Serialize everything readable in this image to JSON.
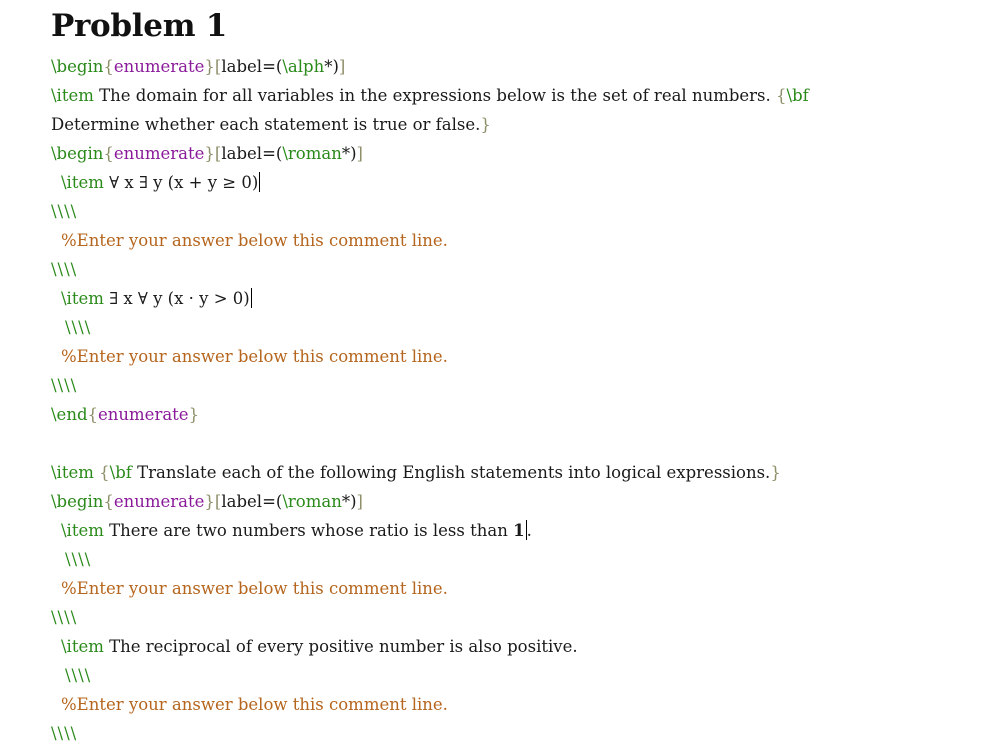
{
  "title": "Problem 1",
  "lines": {
    "begin_outer": {
      "cmd": "\\begin",
      "open": "{",
      "env": "enumerate",
      "close": "}",
      "opt_open": "[",
      "opt_text": "label=(",
      "opt_cmd": "\\alph",
      "opt_tail": "*)",
      "opt_close": "]"
    },
    "item_a": {
      "cmd": "\\item",
      "text": " The domain for all variables in the expressions below is the set of real numbers. ",
      "bf_open": "{",
      "bf_cmd": "\\bf",
      "bf_text": " Determine whether each statement is true or false.",
      "bf_close": "}"
    },
    "begin_inner1": {
      "cmd": "\\begin",
      "open": "{",
      "env": "enumerate",
      "close": "}",
      "opt_open": "[",
      "opt_text": "label=(",
      "opt_cmd": "\\roman",
      "opt_tail": "*)",
      "opt_close": "]"
    },
    "item_a1": {
      "cmd": "\\item",
      "math": "∀ x ∃ y (x + y ≥ 0)"
    },
    "newline_1": "\\\\\\\\",
    "comment_1": "%Enter your answer below this comment line.",
    "newline_2": "\\\\\\\\",
    "item_a2": {
      "cmd": "\\item",
      "math": "∃ x ∀ y (x · y > 0)"
    },
    "newline_3": "\\\\\\\\",
    "comment_2": "%Enter your answer below this comment line.",
    "newline_4": "\\\\\\\\",
    "end_inner1": {
      "cmd": "\\end",
      "open": "{",
      "env": "enumerate",
      "close": "}"
    },
    "item_b": {
      "cmd": "\\item",
      "bf_open": "{",
      "bf_cmd": "\\bf",
      "bf_text": " Translate each of the following English statements into logical expressions.",
      "bf_close": "}"
    },
    "begin_inner2": {
      "cmd": "\\begin",
      "open": "{",
      "env": "enumerate",
      "close": "}",
      "opt_open": "[",
      "opt_text": "label=(",
      "opt_cmd": "\\roman",
      "opt_tail": "*)",
      "opt_close": "]"
    },
    "item_b1": {
      "cmd": "\\item",
      "text": " There are two numbers whose ratio is less than ",
      "bold": "1",
      "tail": "."
    },
    "newline_5": "\\\\\\\\",
    "comment_3": "%Enter your answer below this comment line.",
    "newline_6": "\\\\\\\\",
    "item_b2": {
      "cmd": "\\item",
      "text": " The reciprocal of every positive number is also positive."
    },
    "newline_7": "\\\\\\\\",
    "comment_4": "%Enter your answer below this comment line.",
    "newline_8": "\\\\\\\\"
  },
  "colors": {
    "command": "#2a8a1a",
    "environment": "#8a1a9a",
    "brace": "#8f8f6a",
    "comment": "#b5651d",
    "text": "#1a1a1a"
  }
}
